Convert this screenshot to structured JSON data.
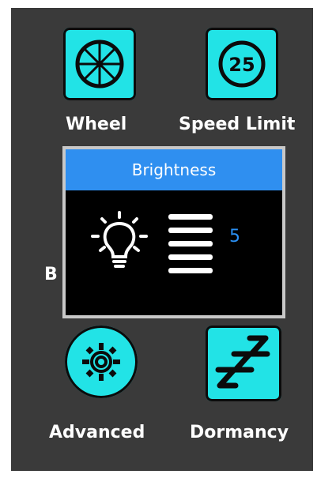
{
  "menu": {
    "items": [
      {
        "label": "Wheel",
        "icon": "wheel-icon"
      },
      {
        "label": "Speed Limit",
        "icon": "speed-limit-icon",
        "badge": "25"
      },
      {
        "label": "Advanced",
        "icon": "gear-icon"
      },
      {
        "label": "Dormancy",
        "icon": "sleep-zzz-icon"
      }
    ],
    "partially_hidden_label": "B"
  },
  "dialog": {
    "title": "Brightness",
    "icon": "light-bulb-icon",
    "level": "5",
    "level_fraction": 1
  },
  "colors": {
    "background": "#3a3a3a",
    "tile": "#22e3e6",
    "dialog_header": "#2f8ff0",
    "level_text": "#2a8ff3"
  }
}
